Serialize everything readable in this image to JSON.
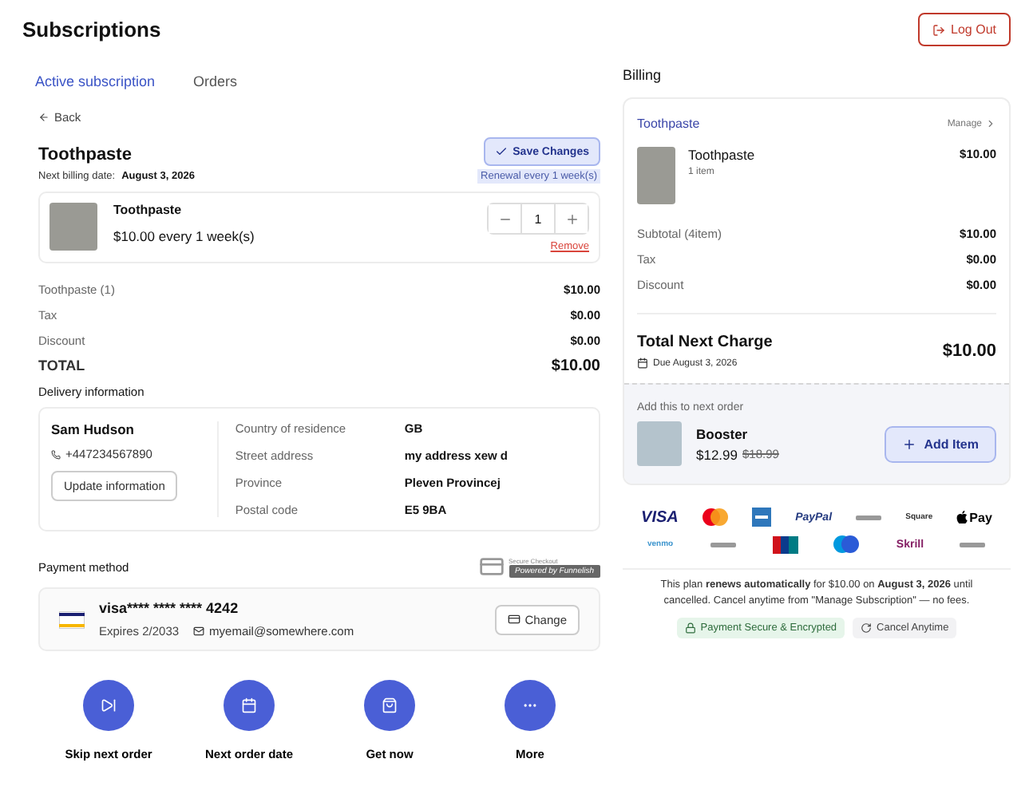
{
  "header": {
    "title": "Subscriptions",
    "logout": "Log Out"
  },
  "tabs": [
    {
      "label": "Active subscription",
      "selected": true
    },
    {
      "label": "Orders",
      "selected": false
    }
  ],
  "detail": {
    "back": "Back",
    "title": "Toothpaste",
    "save": "Save Changes",
    "billing_label": "Next billing date:",
    "billing_date": "August 3, 2026",
    "renewal": "Renewal every 1 week(s)",
    "product": {
      "name": "Toothpaste",
      "price": "$10.00 every 1 week(s)",
      "quantity": "1",
      "remove": "Remove"
    },
    "summary": [
      {
        "label": "Toothpaste (1)",
        "value": "$10.00",
        "total": false
      },
      {
        "label": "Tax",
        "value": "$0.00",
        "total": false
      },
      {
        "label": "Discount",
        "value": "$0.00",
        "total": false
      },
      {
        "label": "TOTAL",
        "value": "$10.00",
        "total": true
      }
    ]
  },
  "delivery": {
    "heading": "Delivery information",
    "name": "Sam Hudson",
    "phone": "+447234567890",
    "update": "Update information",
    "fields": [
      {
        "label": "Country of residence",
        "value": "GB"
      },
      {
        "label": "Street address",
        "value": "my address xew d"
      },
      {
        "label": "Province",
        "value": "Pleven Provincej"
      },
      {
        "label": "Postal code",
        "value": "E5 9BA"
      }
    ]
  },
  "payment": {
    "heading": "Payment method",
    "secure": "Secure Checkout",
    "powered": "Powered by Funnelish",
    "card": "visa**** **** **** 4242",
    "expires": "Expires 2/2033",
    "email": "myemail@somewhere.com",
    "change": "Change"
  },
  "actions": [
    {
      "kind": "skip",
      "label": "Skip next order"
    },
    {
      "kind": "calendar",
      "label": "Next order date"
    },
    {
      "kind": "bag",
      "label": "Get now"
    },
    {
      "kind": "more",
      "label": "More"
    }
  ],
  "billing": {
    "heading": "Billing",
    "product": "Toothpaste",
    "manage": "Manage",
    "item": {
      "name": "Toothpaste",
      "count": "1 item",
      "price": "$10.00"
    },
    "rows": [
      {
        "label": "Subtotal (4item)",
        "value": "$10.00"
      },
      {
        "label": "Tax",
        "value": "$0.00"
      },
      {
        "label": "Discount",
        "value": "$0.00"
      }
    ],
    "total_label": "Total Next Charge",
    "due": "Due August 3, 2026",
    "total": "$10.00",
    "upsell": {
      "heading": "Add this to next order",
      "name": "Booster",
      "price": "$12.99",
      "old_price": "$18.99",
      "button": "Add Item"
    }
  },
  "payment_logos": [
    [
      {
        "kind": "visa",
        "label": "VISA"
      },
      {
        "kind": "mastercard"
      },
      {
        "kind": "amex"
      },
      {
        "kind": "paypal",
        "label": "PayPal"
      },
      {
        "kind": "tiny"
      },
      {
        "kind": "square",
        "label": "Square"
      },
      {
        "kind": "applepay",
        "label": "Pay"
      }
    ],
    [
      {
        "kind": "venmo",
        "label": "venmo"
      },
      {
        "kind": "tiny"
      },
      {
        "kind": "unionpay"
      },
      {
        "kind": "maestro"
      },
      {
        "kind": "skrill",
        "label": "Skrill"
      },
      {
        "kind": "tiny"
      }
    ]
  ],
  "notice": "This plan **renews automatically** for $10.00 on **August 3, 2026** until cancelled. Cancel anytime from \"Manage Subscription\" — no fees.",
  "badges": [
    {
      "kind": "secure",
      "label": "Payment Secure & Encrypted"
    },
    {
      "kind": "cancel",
      "label": "Cancel Anytime"
    }
  ]
}
